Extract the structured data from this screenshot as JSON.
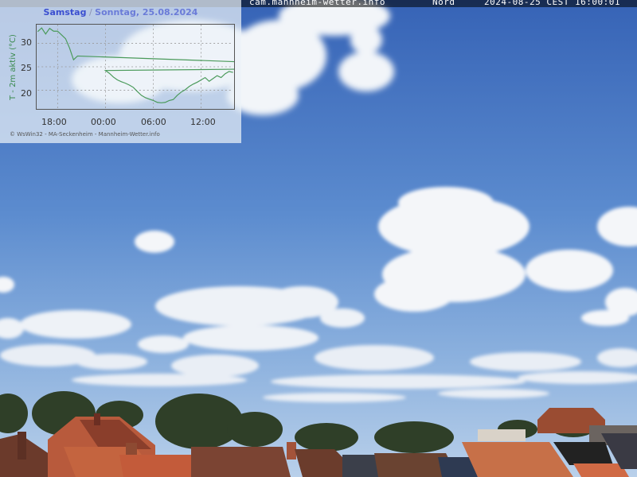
{
  "header": {
    "site": "cam.mannheim-wetter.info",
    "direction": "Nord",
    "timestamp": "2024-08-25 CEST 16:00:01"
  },
  "overlay": {
    "title_sat": "Samstag",
    "title_sep": " / ",
    "title_sun": "Sonntag, 25.08.2024",
    "y_axis_label": "T - 2m aktiv (°C)",
    "y_ticks": [
      "30",
      "25",
      "20"
    ],
    "x_ticks": [
      "18:00",
      "00:00",
      "06:00",
      "12:00"
    ],
    "credit": "© WsWin32 - MA-Seckenheim - Mannheim-Wetter.info"
  },
  "chart_data": {
    "type": "line",
    "xlabel": "",
    "ylabel": "T - 2m aktiv (°C)",
    "x_ticks": [
      "18:00",
      "00:00",
      "06:00",
      "12:00"
    ],
    "ylim": [
      16,
      34
    ],
    "grid": true,
    "series": [
      {
        "x": [
          "15:30",
          "16:00",
          "16:30",
          "17:00",
          "17:30",
          "18:00",
          "18:30",
          "19:00",
          "19:30",
          "20:00",
          "20:30",
          "21:00",
          "21:30",
          "22:00",
          "22:30",
          "23:00",
          "23:30",
          "00:00",
          "00:30",
          "01:00",
          "01:30",
          "02:00",
          "02:30",
          "03:00",
          "03:30",
          "04:00",
          "04:30",
          "05:00",
          "05:30",
          "06:00",
          "06:30",
          "07:00",
          "07:30",
          "08:00",
          "08:30",
          "09:00",
          "09:30",
          "10:00",
          "10:30",
          "11:00",
          "11:30",
          "12:00",
          "12:30",
          "13:00",
          "13:30",
          "14:00",
          "14:30",
          "15:00",
          "15:30",
          "16:00"
        ],
        "values": [
          32.5,
          33.3,
          32.0,
          33.2,
          32.6,
          32.6,
          31.8,
          31.0,
          29.0,
          26.5,
          27.3,
          25.8,
          26.7,
          25.6,
          25.9,
          24.9,
          24.6,
          24.2,
          23.6,
          22.8,
          22.2,
          21.8,
          21.5,
          21.1,
          20.6,
          19.7,
          18.9,
          18.4,
          18.1,
          17.8,
          17.4,
          17.3,
          17.4,
          17.8,
          18.0,
          18.9,
          19.6,
          20.1,
          20.8,
          21.3,
          21.7,
          22.2,
          22.7,
          21.9,
          22.5,
          23.1,
          22.7,
          23.5,
          24.0,
          23.8
        ],
        "color": "#4a9a5a"
      }
    ]
  },
  "colors": {
    "sky_top": "#3f6cbf",
    "sky_bottom": "#a9c7e6",
    "line": "#4a9a5a",
    "title": "#3b4fd0"
  }
}
